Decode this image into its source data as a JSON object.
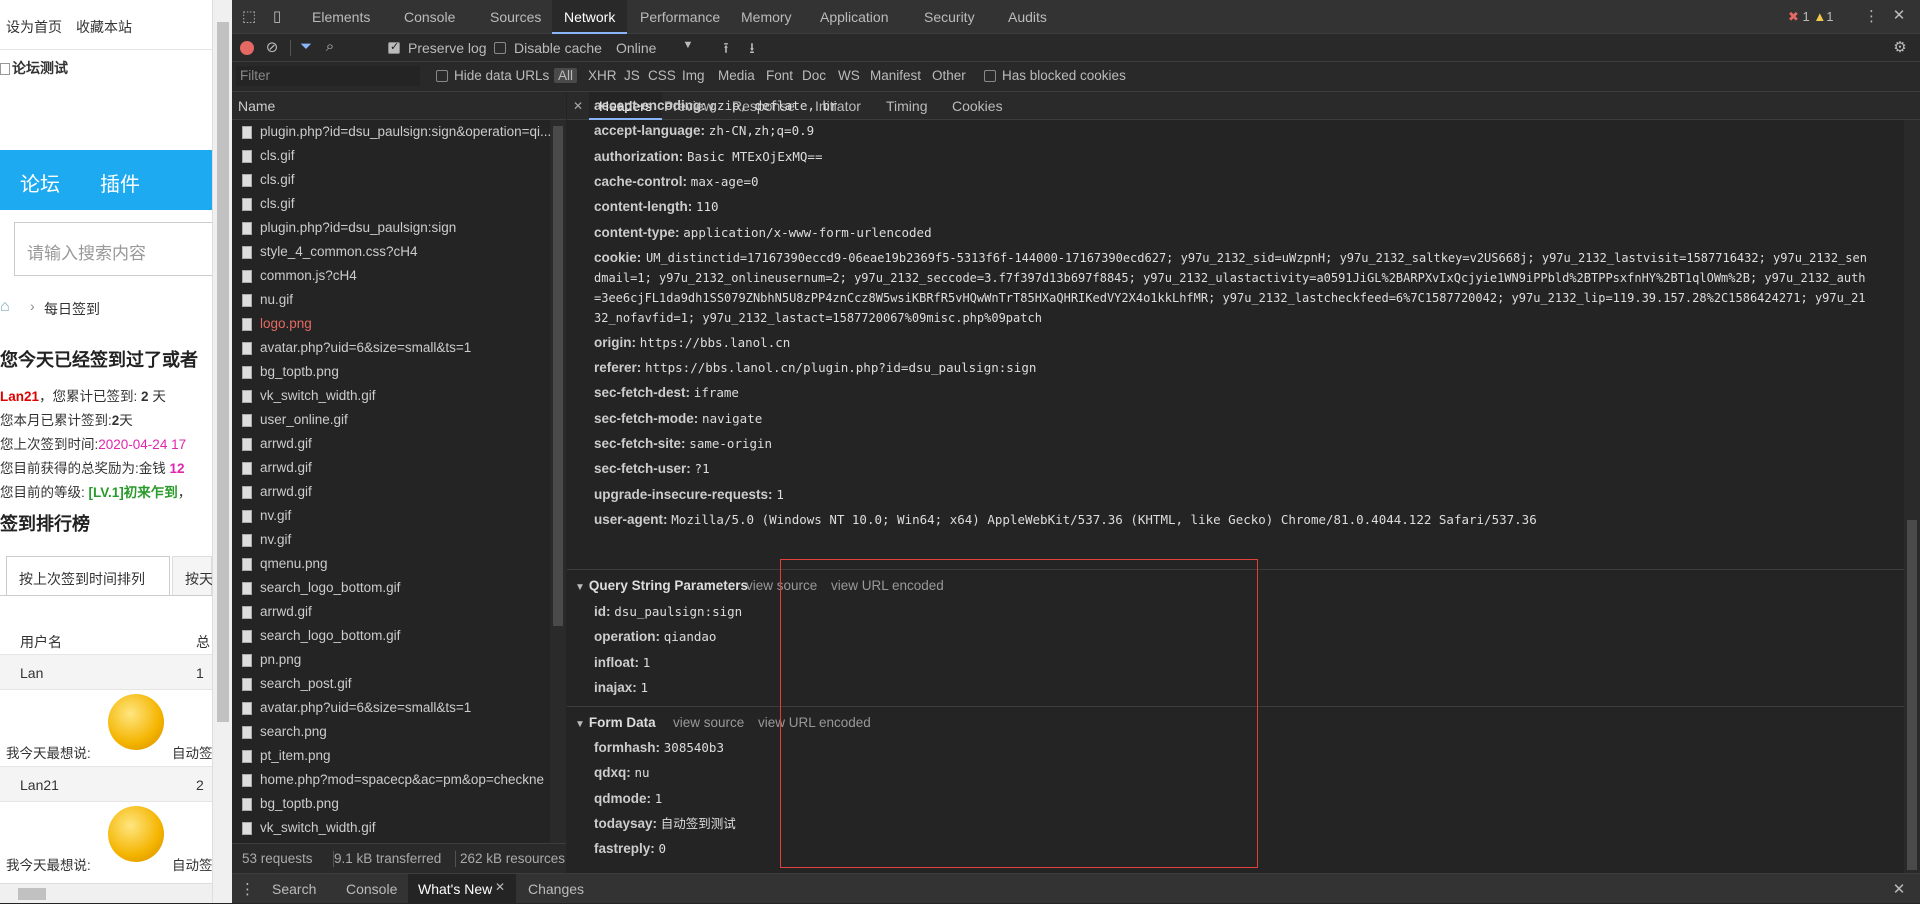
{
  "page": {
    "top_links": [
      "设为首页",
      "收藏本站"
    ],
    "logo_alt": "论坛测试",
    "nav": [
      "论坛",
      "插件"
    ],
    "search_placeholder": "请输入搜索内容",
    "breadcrumb": "每日签到",
    "signed_msg": "您今天已经签到过了或者",
    "info_lines": [
      {
        "pre": "Lan21",
        "mid": "，您累计已签到: ",
        "strong": "2",
        "post": " 天"
      },
      {
        "pre": "",
        "mid": "您本月已累计签到:",
        "strong": "2",
        "post": "天"
      },
      {
        "pre": "",
        "mid": "您上次签到时间:",
        "strong": "2020-04-24 17",
        "post": ""
      },
      {
        "pre": "",
        "mid": "您目前获得的总奖励为:金钱 ",
        "strong": "12",
        "post": ""
      },
      {
        "pre": "",
        "mid": "您目前的等级: ",
        "strong": "[LV.1]初来乍到",
        "post": "，"
      }
    ],
    "rank_title": "签到排行榜",
    "rank_tabs": [
      "按上次签到时间排列",
      "按天"
    ],
    "table_head": [
      "用户名",
      "总"
    ],
    "rows": [
      {
        "user": "Lan",
        "num": "1",
        "say_label": "我今天最想说:",
        "say": "自动签"
      },
      {
        "user": "Lan21",
        "num": "2",
        "say_label": "我今天最想说:",
        "say": "自动签"
      }
    ]
  },
  "devtools": {
    "tabs": [
      "Elements",
      "Console",
      "Sources",
      "Network",
      "Performance",
      "Memory",
      "Application",
      "Security",
      "Audits"
    ],
    "active_tab": "Network",
    "errors": "1",
    "warnings": "1",
    "toolbar": {
      "preserve_log": "Preserve log",
      "disable_cache": "Disable cache",
      "throttle": "Online"
    },
    "filter": {
      "placeholder": "Filter",
      "hide_data_urls": "Hide data URLs",
      "types": [
        "All",
        "XHR",
        "JS",
        "CSS",
        "Img",
        "Media",
        "Font",
        "Doc",
        "WS",
        "Manifest",
        "Other"
      ],
      "blocked": "Has blocked cookies"
    },
    "list_header": "Name",
    "requests": [
      "plugin.php?id=dsu_paulsign:sign&operation=qi...",
      "cls.gif",
      "cls.gif",
      "cls.gif",
      "plugin.php?id=dsu_paulsign:sign",
      "style_4_common.css?cH4",
      "common.js?cH4",
      "nu.gif",
      "logo.png",
      "avatar.php?uid=6&size=small&ts=1",
      "bg_toptb.png",
      "vk_switch_width.gif",
      "user_online.gif",
      "arrwd.gif",
      "arrwd.gif",
      "arrwd.gif",
      "nv.gif",
      "nv.gif",
      "qmenu.png",
      "search_logo_bottom.gif",
      "arrwd.gif",
      "search_logo_bottom.gif",
      "pn.png",
      "search_post.gif",
      "avatar.php?uid=6&size=small&ts=1",
      "search.png",
      "pt_item.png",
      "home.php?mod=spacecp&ac=pm&op=checkne",
      "bg_toptb.png",
      "vk_switch_width.gif"
    ],
    "error_request": "logo.png",
    "status": {
      "requests": "53 requests",
      "transferred": "9.1 kB transferred",
      "resources": "262 kB resources"
    },
    "detail_tabs": [
      "Headers",
      "Preview",
      "Response",
      "Initiator",
      "Timing",
      "Cookies"
    ],
    "headers": [
      {
        "k": "accept-encoding:",
        "v": "gzip, deflate, br"
      },
      {
        "k": "accept-language:",
        "v": "zh-CN,zh;q=0.9"
      },
      {
        "k": "authorization:",
        "v": "Basic MTExOjExMQ=="
      },
      {
        "k": "cache-control:",
        "v": "max-age=0"
      },
      {
        "k": "content-length:",
        "v": "110"
      },
      {
        "k": "content-type:",
        "v": "application/x-www-form-urlencoded"
      }
    ],
    "cookie": {
      "k": "cookie:",
      "lines": [
        "UM_distinctid=17167390eccd9-06eae19b2369f5-5313f6f-144000-17167390ecd627; y97u_2132_sid=uWzpnH; y97u_2132_saltkey=v2US668j; y97u_2132_lastvisit=1587716432; y97u_2132_sen",
        "dmail=1; y97u_2132_onlineusernum=2; y97u_2132_seccode=3.f7f397d13b697f8845; y97u_2132_ulastactivity=a0591JiGL%2BARPXvIxQcjyie1WN9iPPbld%2BTPPsxfnHY%2BT1qlOWm%2B; y97u_2132_auth",
        "=3ee6cjFL1da9dh1SS079ZNbhN5U8zPP4znCcz8W5wsiKBRfR5vHQwWnTrT85HXaQHRIKedVY2X4o1kkLhfMR; y97u_2132_lastcheckfeed=6%7C1587720042; y97u_2132_lip=119.39.157.28%2C1586424271; y97u_21",
        "32_nofavfid=1; y97u_2132_lastact=1587720067%09misc.php%09patch"
      ]
    },
    "headers2": [
      {
        "k": "origin:",
        "v": "https://bbs.lanol.cn"
      },
      {
        "k": "referer:",
        "v": "https://bbs.lanol.cn/plugin.php?id=dsu_paulsign:sign"
      },
      {
        "k": "sec-fetch-dest:",
        "v": "iframe"
      },
      {
        "k": "sec-fetch-mode:",
        "v": "navigate"
      },
      {
        "k": "sec-fetch-site:",
        "v": "same-origin"
      },
      {
        "k": "sec-fetch-user:",
        "v": "?1"
      },
      {
        "k": "upgrade-insecure-requests:",
        "v": "1"
      },
      {
        "k": "user-agent:",
        "v": "Mozilla/5.0 (Windows NT 10.0; Win64; x64) AppleWebKit/537.36 (KHTML, like Gecko) Chrome/81.0.4044.122 Safari/537.36"
      }
    ],
    "query": {
      "title": "Query String Parameters",
      "view_source": "view source",
      "view_encoded": "view URL encoded",
      "params": [
        {
          "k": "id:",
          "v": "dsu_paulsign:sign"
        },
        {
          "k": "operation:",
          "v": "qiandao"
        },
        {
          "k": "infloat:",
          "v": "1"
        },
        {
          "k": "inajax:",
          "v": "1"
        }
      ]
    },
    "form": {
      "title": "Form Data",
      "view_source": "view source",
      "view_encoded": "view URL encoded",
      "params": [
        {
          "k": "formhash:",
          "v": "308540b3"
        },
        {
          "k": "qdxq:",
          "v": "nu"
        },
        {
          "k": "qdmode:",
          "v": "1"
        },
        {
          "k": "todaysay:",
          "v": "自动签到测试"
        },
        {
          "k": "fastreply:",
          "v": "0"
        }
      ]
    },
    "drawer": [
      "Search",
      "Console",
      "What's New",
      "Changes"
    ],
    "drawer_active": "What's New"
  },
  "colors": {
    "accent": "#8ab4f8",
    "forum_blue": "#1eaaf1",
    "highlight": "#e0403a",
    "rank_red": "#e00000",
    "pink": "#e024b0",
    "green": "#2a9a2a"
  }
}
